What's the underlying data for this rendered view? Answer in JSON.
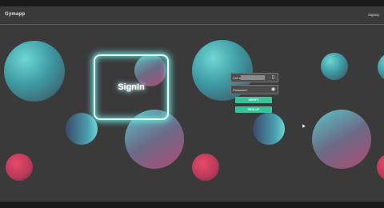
{
  "header": {
    "brand": "Gymapp",
    "signup_link": "Signup"
  },
  "signin_card": {
    "title": "SignIn"
  },
  "form": {
    "cell_placeholder": "Cell #",
    "password_placeholder": "Password",
    "verify_label": "VERIFY",
    "signup_label": "SIGN UP"
  },
  "colors": {
    "background": "#3a3a3b",
    "accent": "#39c39c",
    "glow": "#6ee4dd"
  },
  "icons": [
    "phone-icon",
    "eye-icon"
  ]
}
